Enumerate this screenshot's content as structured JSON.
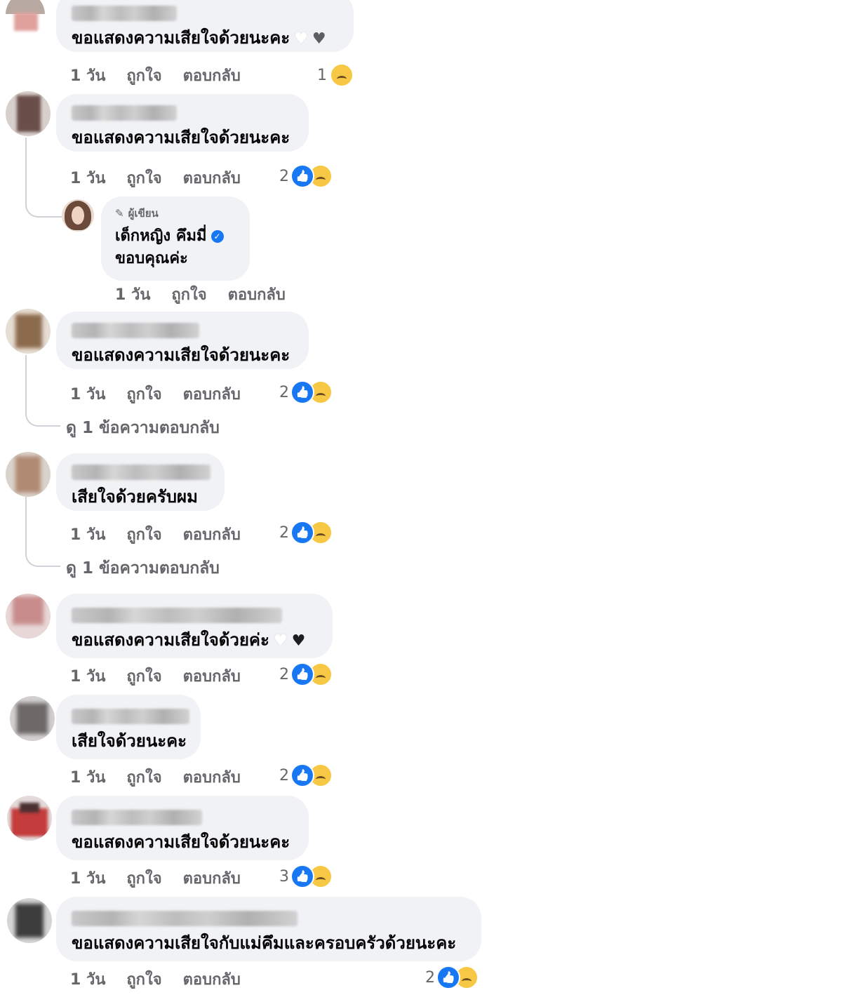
{
  "actions": {
    "time": "1 วัน",
    "like": "ถูกใจ",
    "reply": "ตอบกลับ"
  },
  "comments": [
    {
      "text": "ขอแสดงความเสียใจด้วยนะคะ",
      "reaction_count": "1",
      "reactions": [
        "sad"
      ],
      "hearts": [
        "white",
        "grey"
      ]
    },
    {
      "text": "ขอแสดงความเสียใจด้วยนะคะ",
      "reaction_count": "2",
      "reactions": [
        "like",
        "sad"
      ]
    },
    {
      "text": "ขอแสดงความเสียใจด้วยนะคะ",
      "reaction_count": "2",
      "reactions": [
        "like",
        "sad"
      ],
      "view_replies": "ดู 1 ข้อความตอบกลับ"
    },
    {
      "text": "เสียใจด้วยครับผม",
      "reaction_count": "2",
      "reactions": [
        "like",
        "sad"
      ],
      "view_replies": "ดู 1 ข้อความตอบกลับ"
    },
    {
      "text": "ขอแสดงความเสียใจด้วยค่ะ",
      "reaction_count": "2",
      "reactions": [
        "like",
        "sad"
      ],
      "hearts": [
        "white",
        "black"
      ]
    },
    {
      "text": "เสียใจด้วยนะคะ",
      "reaction_count": "2",
      "reactions": [
        "like",
        "sad"
      ]
    },
    {
      "text": "ขอแสดงความเสียใจด้วยนะคะ",
      "reaction_count": "3",
      "reactions": [
        "like",
        "sad"
      ]
    },
    {
      "text": "ขอแสดงความเสียใจกับแม่คึมและครอบครัวด้วยนะคะ",
      "reaction_count": "2",
      "reactions": [
        "like",
        "sad"
      ]
    }
  ],
  "author_reply": {
    "badge": "ผู้เขียน",
    "name": "เด็กหญิง คึมมี่",
    "text": "ขอบคุณค่ะ",
    "verified": true
  },
  "colors": {
    "bubble": "#f0f2f5",
    "secondary_text": "#65676b",
    "like_blue": "#1877f2",
    "sad_yellow": "#f7c844"
  }
}
